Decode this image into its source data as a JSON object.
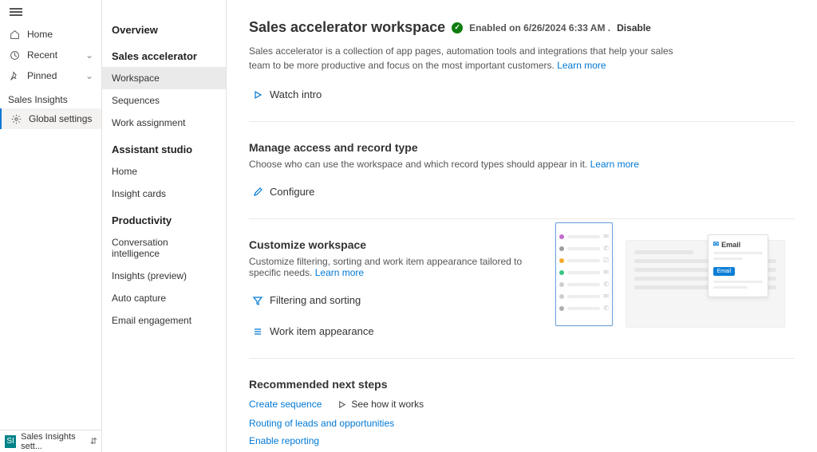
{
  "rail": {
    "home": "Home",
    "recent": "Recent",
    "pinned": "Pinned",
    "section": "Sales Insights",
    "global": "Global settings"
  },
  "footer": {
    "badge": "SI",
    "label": "Sales Insights sett..."
  },
  "sidebar": {
    "overview_h": "Overview",
    "sales_h": "Sales accelerator",
    "workspace": "Workspace",
    "sequences": "Sequences",
    "work_assign": "Work assignment",
    "assistant_h": "Assistant studio",
    "as_home": "Home",
    "as_cards": "Insight cards",
    "prod_h": "Productivity",
    "conv": "Conversation intelligence",
    "insights": "Insights (preview)",
    "auto": "Auto capture",
    "email": "Email engagement"
  },
  "main": {
    "title": "Sales accelerator workspace",
    "enabled_prefix": "Enabled on",
    "enabled_ts": "6/26/2024 6:33 AM .",
    "disable": "Disable",
    "desc": "Sales accelerator is a collection of app pages, automation tools and integrations that help your sales team to be more productive and focus on the most important customers.",
    "learn_more": "Learn more",
    "watch_intro": "Watch intro",
    "manage_h": "Manage access and record type",
    "manage_d": "Choose who can use the workspace and which record types should appear in it.",
    "configure": "Configure",
    "custom_h": "Customize workspace",
    "custom_d": "Customize filtering, sorting and work item appearance tailored to specific needs.",
    "filter_sort": "Filtering and sorting",
    "work_item": "Work item appearance",
    "rec_h": "Recommended next steps",
    "create_seq": "Create sequence",
    "see_how": "See how it works",
    "routing": "Routing of leads and opportunities",
    "enable_rep": "Enable reporting",
    "illus_email": "Email",
    "illus_btn": "Email"
  }
}
